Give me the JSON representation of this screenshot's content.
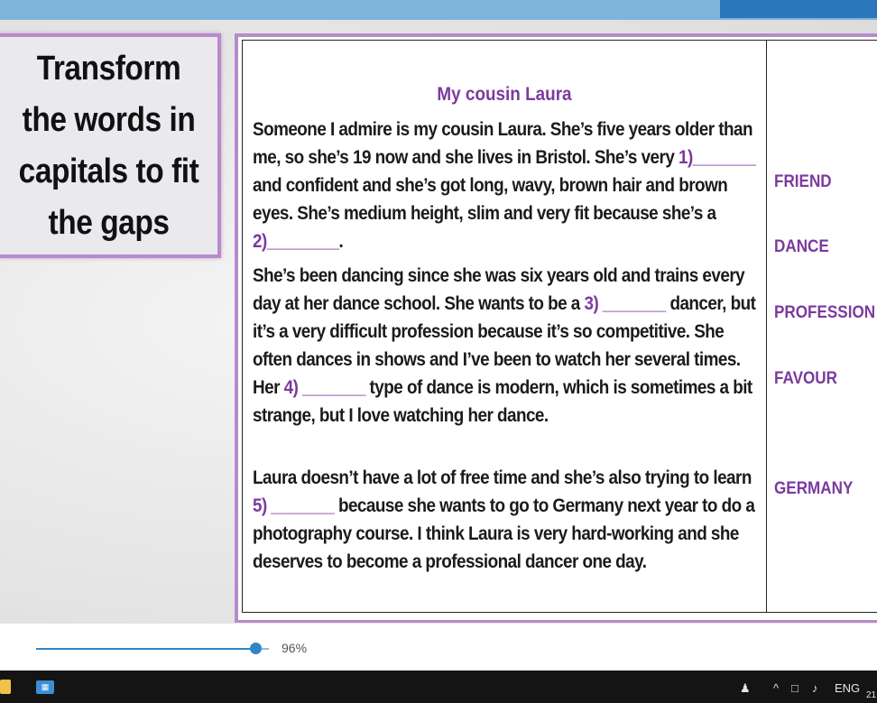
{
  "slide": {
    "instruction": "Transform the words in capitals to fit the gaps"
  },
  "document": {
    "title": "My cousin  Laura",
    "paragraph1": {
      "a": "Someone I admire is my cousin Laura. She’s five years older than me, so she’s 19 now and she lives in Bristol. She’s very ",
      "gap1": "1)_______",
      "b": " and confident and she’s got long, wavy, brown hair and brown eyes. She’s medium height, slim and very fit because she’s a ",
      "gap2": "2)________",
      "c": "."
    },
    "paragraph2": {
      "a": "She’s been dancing since she was six years old and trains every day at her dance school. She wants to be a ",
      "gap3": "3) _______",
      "b": " dancer, but it’s a very difficult profession because it’s so competitive. She often dances in shows and I’ve been to watch her several times. Her ",
      "gap4": "4) _______",
      "c": " type of dance is modern, which is sometimes  a bit strange, but I love watching her dance."
    },
    "paragraph3": {
      "a": "Laura doesn’t have a lot of free time and she’s also trying to learn ",
      "gap5": "5) _______",
      "b": " because she wants to go to Germany next year to do a photography course. I think Laura is very hard-working and she deserves to become a professional dancer one day."
    },
    "words": [
      "FRIEND",
      "DANCE",
      "PROFESSION",
      "FAVOUR",
      "GERMANY"
    ]
  },
  "viewer": {
    "zoom_label": "96%",
    "zoom_value": 0.96
  },
  "taskbar": {
    "language": "ENG",
    "clock": "21",
    "tray_icons": [
      "people-icon",
      "chevron-up-icon",
      "network-icon",
      "volume-icon"
    ]
  }
}
